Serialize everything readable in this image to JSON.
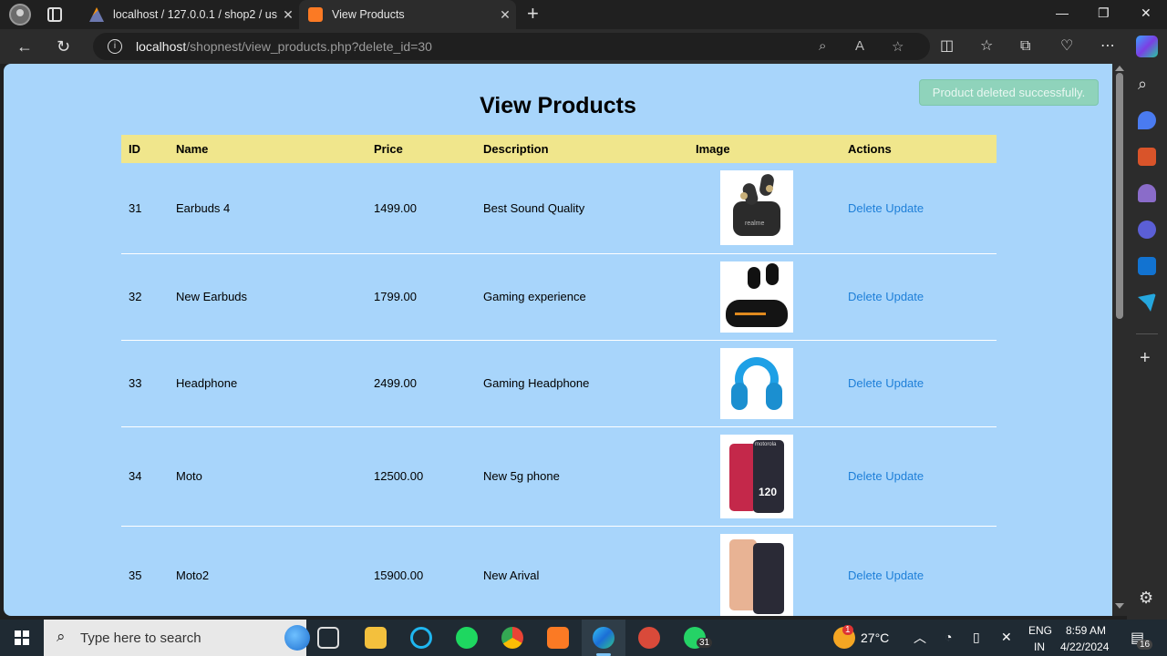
{
  "browser": {
    "tabs": [
      {
        "title": "localhost / 127.0.0.1 / shop2 / us",
        "favicon": "phpmyadmin-icon",
        "active": false
      },
      {
        "title": "View Products",
        "favicon": "xampp-icon",
        "active": true
      }
    ],
    "address": {
      "host": "localhost",
      "path": "/shopnest/view_products.php?delete_id=30"
    }
  },
  "page": {
    "alert": "Product deleted successfully.",
    "title": "View Products",
    "columns": [
      "ID",
      "Name",
      "Price",
      "Description",
      "Image",
      "Actions"
    ],
    "rows": [
      {
        "id": "31",
        "name": "Earbuds 4",
        "price": "1499.00",
        "description": "Best Sound Quality",
        "image": "earbuds-image",
        "delete": "Delete",
        "update": "Update"
      },
      {
        "id": "32",
        "name": "New Earbuds",
        "price": "1799.00",
        "description": "Gaming experience",
        "image": "gaming-earbuds-image",
        "delete": "Delete",
        "update": "Update"
      },
      {
        "id": "33",
        "name": "Headphone",
        "price": "2499.00",
        "description": "Gaming Headphone",
        "image": "headphone-image",
        "delete": "Delete",
        "update": "Update"
      },
      {
        "id": "34",
        "name": "Moto",
        "price": "12500.00",
        "description": "New 5g phone",
        "image": "red-phone-image",
        "delete": "Delete",
        "update": "Update"
      },
      {
        "id": "35",
        "name": "Moto2",
        "price": "15900.00",
        "description": "New Arival",
        "image": "peach-phone-image",
        "delete": "Delete",
        "update": "Update"
      }
    ],
    "image_text": {
      "earbuds": "realme",
      "phone_brand": "motorola",
      "phone_screen": "120"
    }
  },
  "taskbar": {
    "search_placeholder": "Type here to search",
    "whatsapp_badge": "31",
    "weather": "27°C",
    "weather_badge": "1",
    "lang_1": "ENG",
    "lang_2": "IN",
    "time": "8:59 AM",
    "date": "4/22/2024",
    "notifications": "16"
  },
  "colors": {
    "page_bg": "#a8d5fb",
    "table_header": "#f0e68c",
    "action_link": "#1e7fd8",
    "alert_bg": "#8fd3bb"
  }
}
